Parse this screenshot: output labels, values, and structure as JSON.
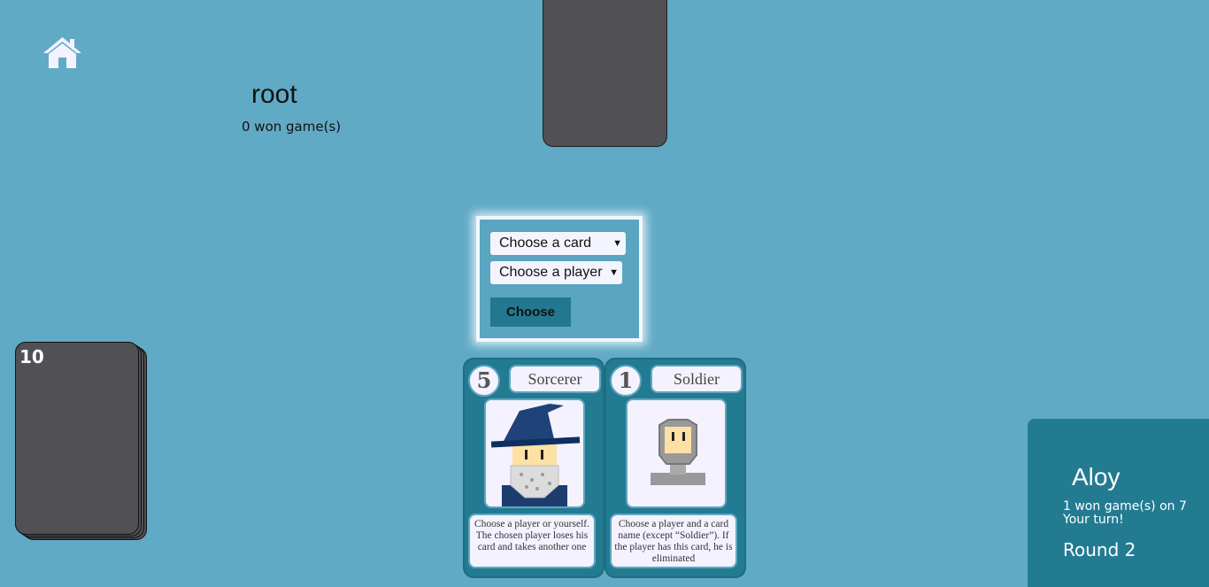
{
  "opponent": {
    "name": "root",
    "wins": "0 won game(s)"
  },
  "deck": {
    "count": "10"
  },
  "action_panel": {
    "card_select": "Choose a card",
    "player_select": "Choose a player",
    "choose_label": "Choose"
  },
  "hand": [
    {
      "value": "5",
      "name": "Sorcerer",
      "description": "Choose a player or yourself. The chosen player loses his card and takes another one"
    },
    {
      "value": "1",
      "name": "Soldier",
      "description": "Choose a player and a card name (except “Soldier”). If the player has this card, he is eliminated"
    }
  ],
  "player": {
    "name": "Aloy",
    "wins": "1 won game(s) on 7",
    "turn": "Your turn!",
    "round": "Round 2"
  },
  "colors": {
    "background": "#60aac6",
    "panel": "#237b92",
    "card_back": "#505055"
  },
  "icons": {
    "home": "home-icon"
  }
}
